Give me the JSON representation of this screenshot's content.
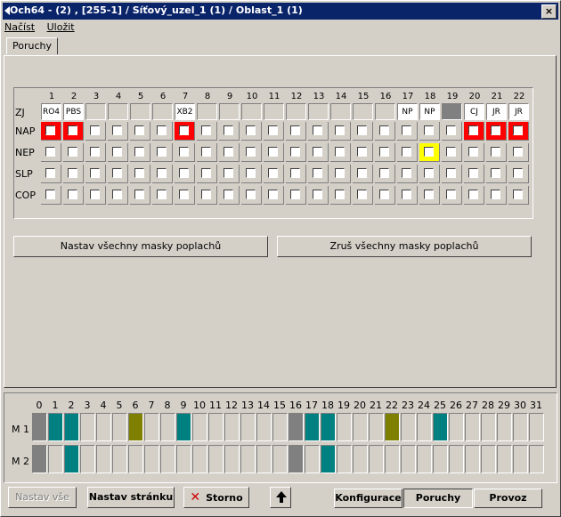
{
  "window": {
    "title": "Och64 - (2) , [255-1] / Síťový_uzel_1 (1) / Oblast_1 (1)",
    "close": "×"
  },
  "menu": {
    "items": [
      "Načíst",
      "Uložit"
    ]
  },
  "tab": {
    "label": "Poruchy"
  },
  "grid": {
    "columns": [
      "1",
      "2",
      "3",
      "4",
      "5",
      "6",
      "7",
      "8",
      "9",
      "10",
      "11",
      "12",
      "13",
      "14",
      "15",
      "16",
      "17",
      "18",
      "19",
      "20",
      "21",
      "22"
    ],
    "rows": [
      "ZJ",
      "NAP",
      "NEP",
      "SLP",
      "COP"
    ],
    "zj": [
      "RO4",
      "PBS",
      "",
      "",
      "",
      "",
      "XB2",
      "",
      "",
      "",
      "",
      "",
      "",
      "",
      "",
      "",
      "NP",
      "NP",
      "",
      "CJ",
      "JR",
      "JR"
    ],
    "zj_styles": [
      "white",
      "white",
      "",
      "",
      "",
      "",
      "white",
      "",
      "",
      "",
      "",
      "",
      "",
      "",
      "",
      "",
      "white",
      "white",
      "gray",
      "white",
      "white",
      "white"
    ],
    "nap_highlight": [
      "red",
      "red",
      "",
      "",
      "",
      "",
      "red",
      "",
      "",
      "",
      "",
      "",
      "",
      "",
      "",
      "",
      "",
      "",
      "",
      "red",
      "red",
      "red"
    ],
    "nep_highlight": [
      "",
      "",
      "",
      "",
      "",
      "",
      "",
      "",
      "",
      "",
      "",
      "",
      "",
      "",
      "",
      "",
      "",
      "yellow",
      "",
      "",
      "",
      ""
    ]
  },
  "buttons": {
    "set_all_masks": "Nastav všechny masky poplachů",
    "clear_all_masks": "Zruš všechny masky poplachů"
  },
  "modules": {
    "numbers": [
      "0",
      "1",
      "2",
      "3",
      "4",
      "5",
      "6",
      "7",
      "8",
      "9",
      "10",
      "11",
      "12",
      "13",
      "14",
      "15",
      "16",
      "17",
      "18",
      "19",
      "20",
      "21",
      "22",
      "23",
      "24",
      "25",
      "26",
      "27",
      "28",
      "29",
      "30",
      "31"
    ],
    "rows": [
      "M 1",
      "M 2"
    ],
    "m1": [
      "gray",
      "teal",
      "teal",
      "",
      "",
      "",
      "olive",
      "",
      "",
      "teal",
      "",
      "",
      "",
      "",
      "",
      "",
      "gray",
      "teal",
      "teal",
      "",
      "",
      "",
      "olive",
      "",
      "",
      "teal",
      "",
      "",
      "",
      "",
      "",
      ""
    ],
    "m2": [
      "gray",
      "",
      "teal",
      "",
      "",
      "",
      "",
      "",
      "",
      "",
      "",
      "",
      "",
      "",
      "",
      "",
      "gray",
      "",
      "teal",
      "",
      "",
      "",
      "",
      "",
      "",
      "",
      "",
      "",
      "",
      "",
      "",
      ""
    ]
  },
  "footer": {
    "set_all": "Nastav vše",
    "set_page": "Nastav stránku",
    "storno": "Storno",
    "config": "Konfigurace",
    "poruchy": "Poruchy",
    "provoz": "Provoz"
  }
}
